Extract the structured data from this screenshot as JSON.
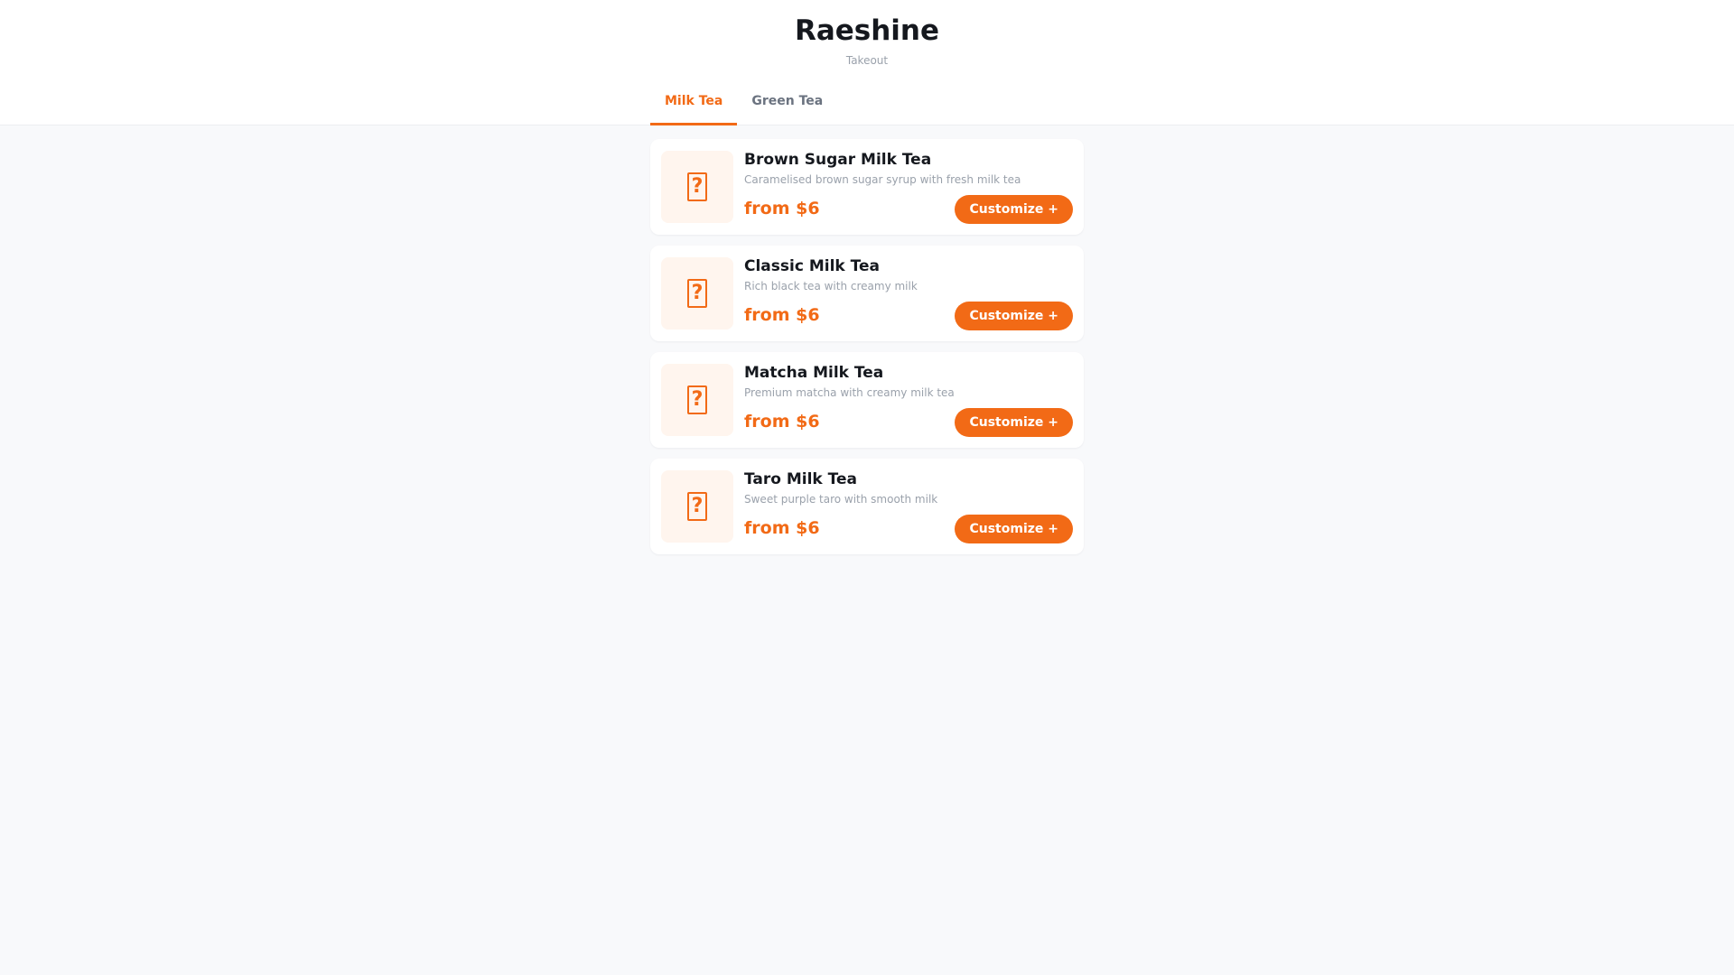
{
  "store": {
    "name": "Raeshine",
    "mode": "Takeout"
  },
  "tabs": [
    {
      "label": "Milk Tea",
      "active": true
    },
    {
      "label": "Green Tea",
      "active": false
    }
  ],
  "items": [
    {
      "name": "Brown Sugar Milk Tea",
      "description": "Caramelised brown sugar syrup with fresh milk tea",
      "price": "from $6",
      "button": "Customize +",
      "icon": "missing-glyph-icon"
    },
    {
      "name": "Classic Milk Tea",
      "description": "Rich black tea with creamy milk",
      "price": "from $6",
      "button": "Customize +",
      "icon": "missing-glyph-icon"
    },
    {
      "name": "Matcha Milk Tea",
      "description": "Premium matcha with creamy milk tea",
      "price": "from $6",
      "button": "Customize +",
      "icon": "missing-glyph-icon"
    },
    {
      "name": "Taro Milk Tea",
      "description": "Sweet purple taro with smooth milk",
      "price": "from $6",
      "button": "Customize +",
      "icon": "missing-glyph-icon"
    }
  ],
  "colors": {
    "accent": "#f26a16",
    "background": "#f8f9fb",
    "card": "#ffffff",
    "thumb_bg": "#fff5ee"
  }
}
